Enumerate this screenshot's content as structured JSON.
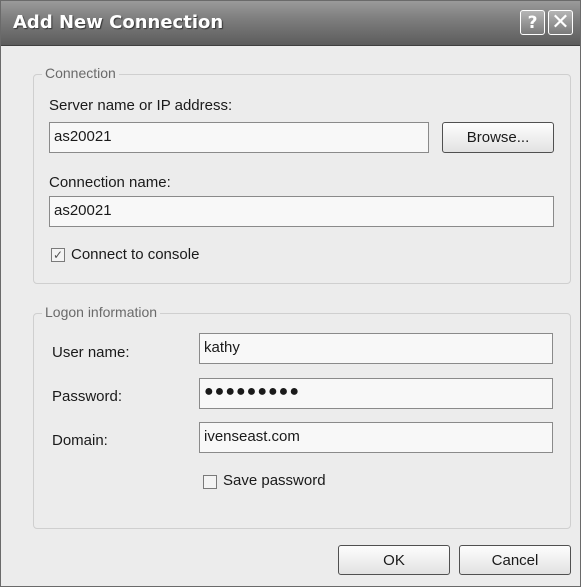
{
  "window": {
    "title": "Add New Connection",
    "help_icon": "help-icon",
    "close_icon": "close-icon",
    "help_glyph": "?",
    "close_glyph": "✕"
  },
  "connection_group": {
    "legend": "Connection",
    "server_label": "Server name or IP address:",
    "server_value": "as20021",
    "browse_label": "Browse...",
    "connection_name_label": "Connection name:",
    "connection_name_value": "as20021",
    "console_checkbox_label": "Connect to console",
    "console_checked": true,
    "check_glyph": "✓"
  },
  "logon_group": {
    "legend": "Logon information",
    "user_label": "User name:",
    "user_value": "kathy",
    "password_label": "Password:",
    "password_value": "●●●●●●●●●",
    "domain_label": "Domain:",
    "domain_value": "ivenseast.com",
    "save_password_label": "Save password",
    "save_password_checked": false
  },
  "footer": {
    "ok_label": "OK",
    "cancel_label": "Cancel"
  }
}
